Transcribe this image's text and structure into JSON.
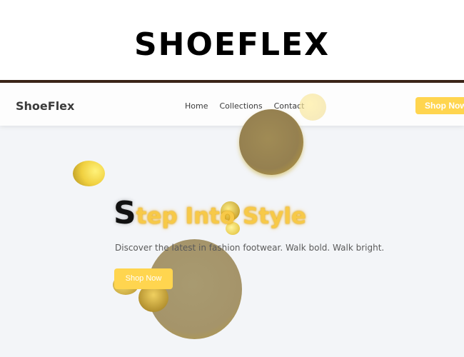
{
  "banner": {
    "title": "SHOEFLEX"
  },
  "site": {
    "brand": "ShoeFlex",
    "nav": [
      "Home",
      "Collections",
      "Contact"
    ],
    "nav_cta": "Shop Now"
  },
  "hero": {
    "heading_first": "S",
    "heading_rest": "tep Into Style",
    "subtitle": "Discover the latest in fashion footwear. Walk bold. Walk bright.",
    "cta": "Shop Now"
  },
  "colors": {
    "accent": "#ffd54f",
    "heading_gold": "#f7c948",
    "background": "#f3f5f8",
    "divider": "#3a2418"
  }
}
